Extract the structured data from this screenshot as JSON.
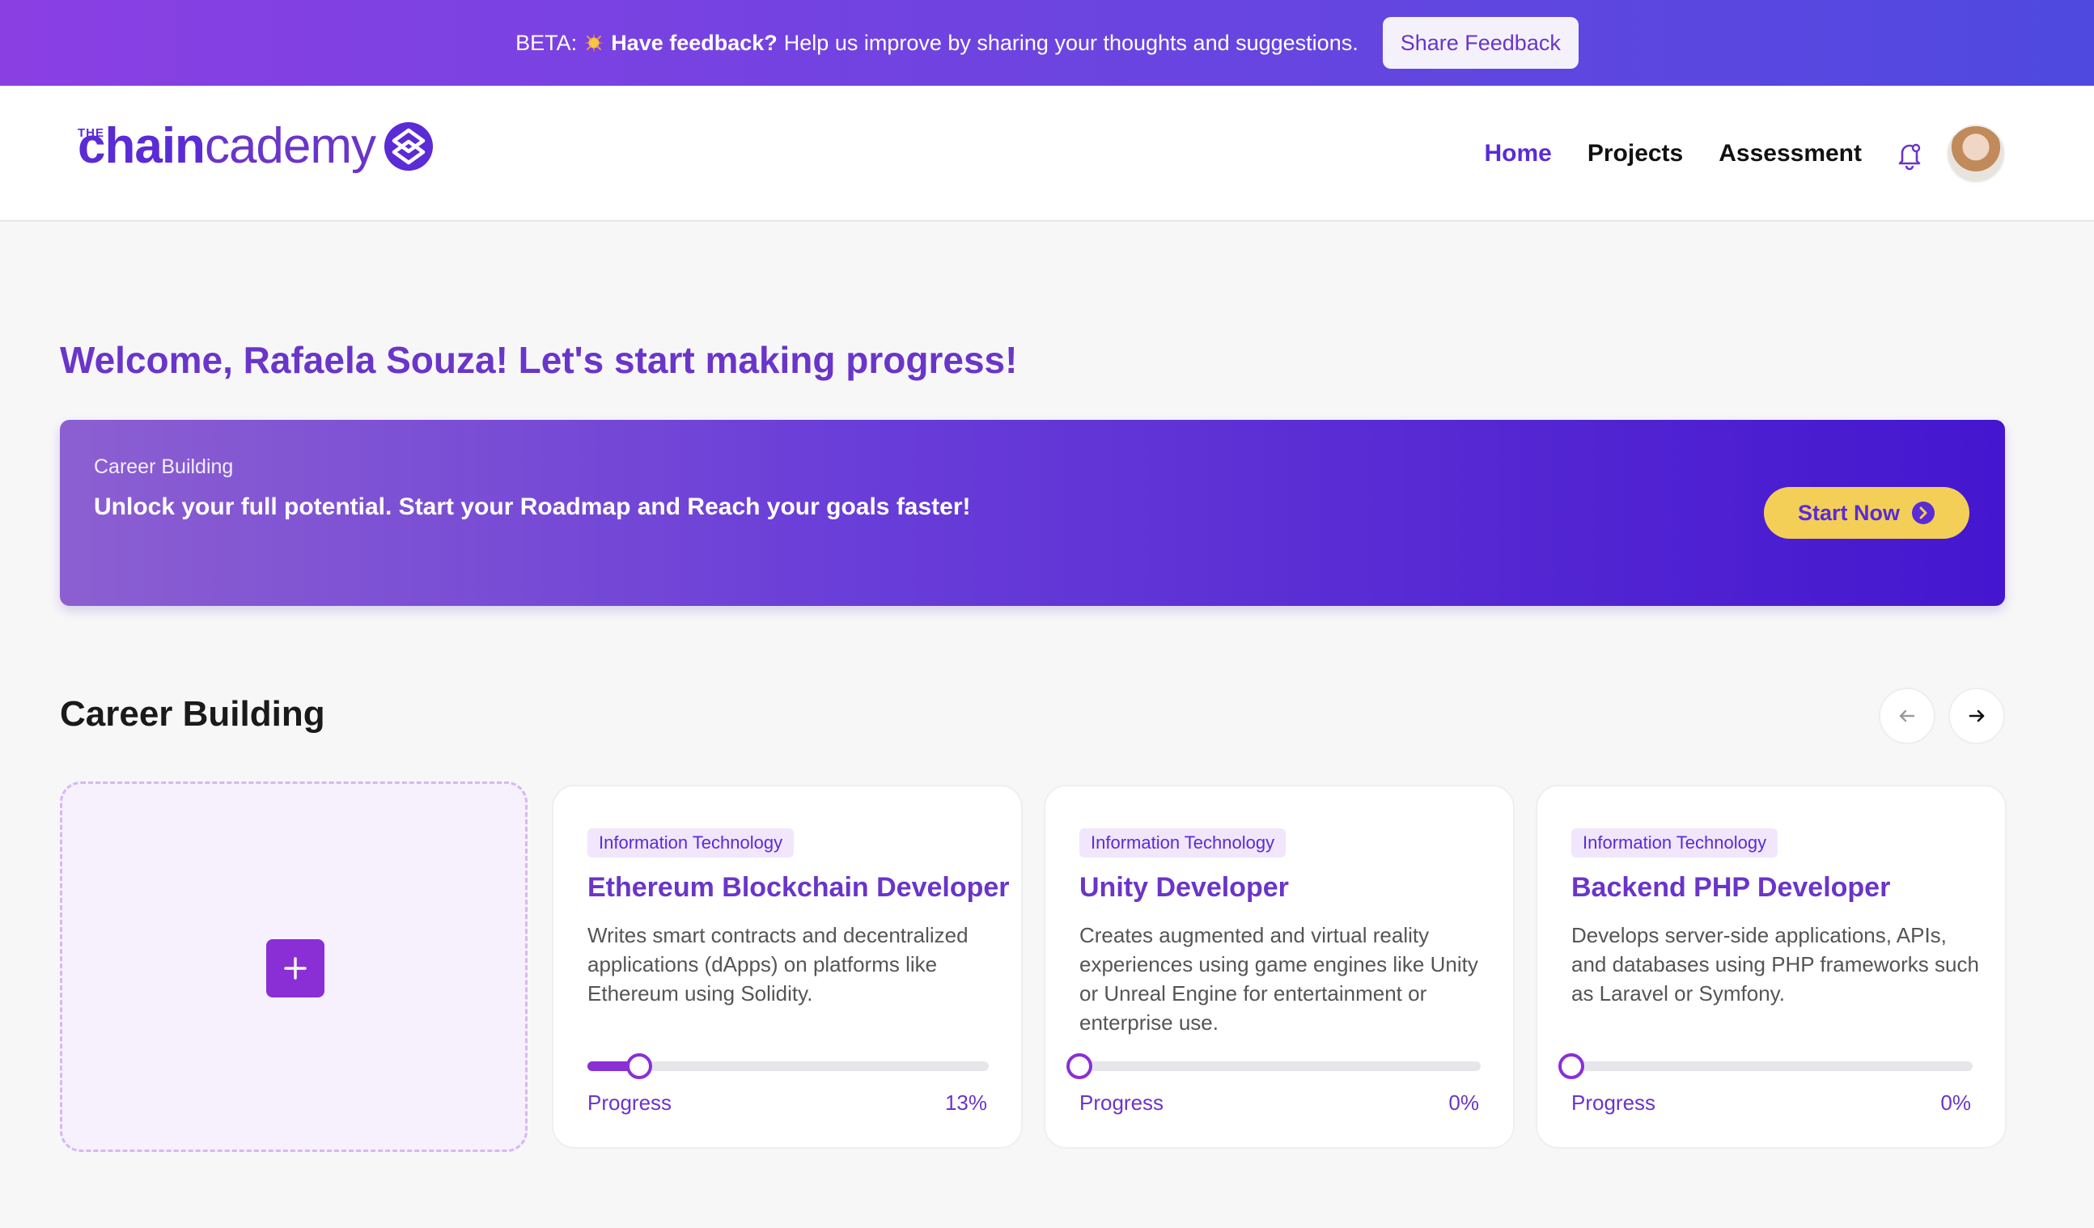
{
  "banner": {
    "prefix": "BETA:",
    "strong": "Have feedback?",
    "rest": "Help us improve by sharing your thoughts and suggestions.",
    "button_label": "Share Feedback",
    "star_icon": "star-sparkle-icon"
  },
  "header": {
    "logo": {
      "small": "THE",
      "chain": "chain",
      "cademy": "cademy"
    },
    "nav": [
      {
        "label": "Home",
        "active": true
      },
      {
        "label": "Projects",
        "active": false
      },
      {
        "label": "Assessment",
        "active": false
      }
    ],
    "bell_icon": "bell-icon",
    "avatar_icon": "user-avatar"
  },
  "welcome": "Welcome, Rafaela Souza! Let's start making progress!",
  "hero": {
    "kicker": "Career Building",
    "title": "Unlock your full potential. Start your Roadmap and Reach your goals faster!",
    "button_label": "Start Now"
  },
  "section": {
    "title": "Career Building",
    "prev_icon": "arrow-left-icon",
    "next_icon": "arrow-right-icon"
  },
  "cards": [
    {
      "tag": "Information Technology",
      "title": "Ethereum Blockchain Developer",
      "desc": "Writes smart contracts and decentralized applications (dApps) on platforms like Ethereum using Solidity.",
      "progress_label": "Progress",
      "progress_text": "13%",
      "progress": 0.13
    },
    {
      "tag": "Information Technology",
      "title": "Unity Developer",
      "desc": "Creates augmented and virtual reality experiences using game engines like Unity or Unreal Engine for entertainment or enterprise use.",
      "progress_label": "Progress",
      "progress_text": "0%",
      "progress": 0
    },
    {
      "tag": "Information Technology",
      "title": "Backend PHP Developer",
      "desc": "Develops server-side applications, APIs, and databases using PHP frameworks such as Laravel or Symfony.",
      "progress_label": "Progress",
      "progress_text": "0%",
      "progress": 0
    }
  ],
  "colors": {
    "brand": "#6a35c9",
    "accent": "#8a2fd6",
    "cta": "#f3cf57"
  }
}
